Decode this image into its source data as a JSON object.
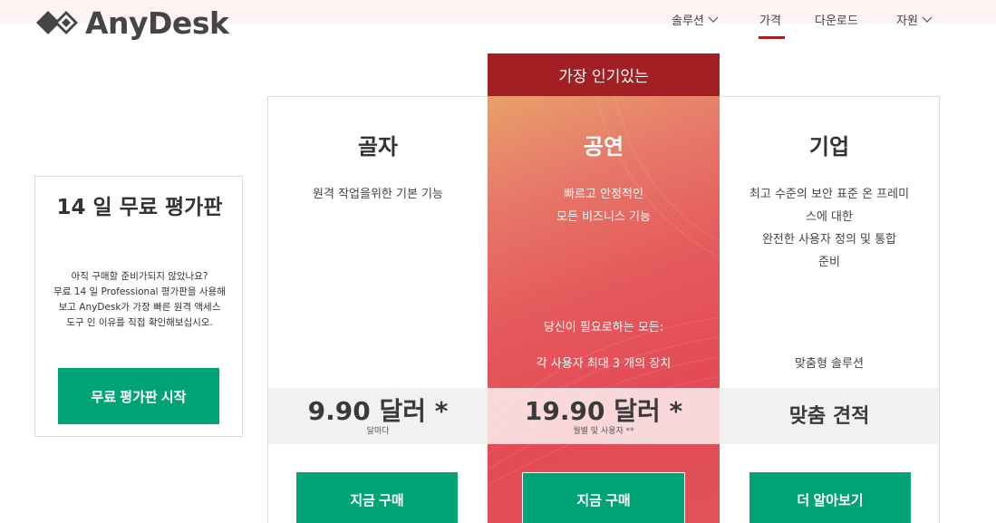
{
  "brand": {
    "name": "AnyDesk",
    "logo_icon": "anydesk-diamond-logo"
  },
  "nav": {
    "items": [
      {
        "label": "솔루션",
        "has_dropdown": true,
        "active": false
      },
      {
        "label": "가격",
        "has_dropdown": false,
        "active": true
      },
      {
        "label": "다운로드",
        "has_dropdown": false,
        "active": false
      },
      {
        "label": "자원",
        "has_dropdown": true,
        "active": false
      }
    ]
  },
  "trial": {
    "title": "14 일 무료 평가판",
    "line1": "아직 구매할 준비가되지 않았나요?",
    "line2": "무료 14 일 Professional 평가판을 사용해",
    "line3": "보고 AnyDesk가 가장 빠른 원격 액세스",
    "line4": "도구 인 이유를 직접 확인해보십시오.",
    "button": "무료 평가판 시작"
  },
  "popular_label": "가장 인기있는",
  "plans": [
    {
      "name": "골자",
      "desc": [
        "원격 작업을위한 기본 기능"
      ],
      "features": [],
      "price": "9.90 달러 *",
      "price_note": "달마다",
      "button": "지금 구매"
    },
    {
      "name": "공연",
      "desc": [
        "빠르고 안정적인",
        "모든 비즈니스 기능"
      ],
      "features": [
        "당신이 필요로하는 모든:",
        "각 사용자 최대 3 개의 장치"
      ],
      "price": "19.90 달러 *",
      "price_note": "월별 및 사용자 **",
      "button": "지금 구매"
    },
    {
      "name": "기업",
      "desc": [
        "최고 수준의 보안 표준 온 프레미",
        "스에 대한",
        "완전한 사용자 정의 및 통합",
        "준비"
      ],
      "features": [
        "맞춤형 솔루션"
      ],
      "price": "맞춤 견적",
      "price_note": "",
      "button": "더 알아보기"
    }
  ],
  "colors": {
    "accent_red": "#a21f24",
    "button_green": "#00a376",
    "text_dark": "#3a3a3a"
  }
}
